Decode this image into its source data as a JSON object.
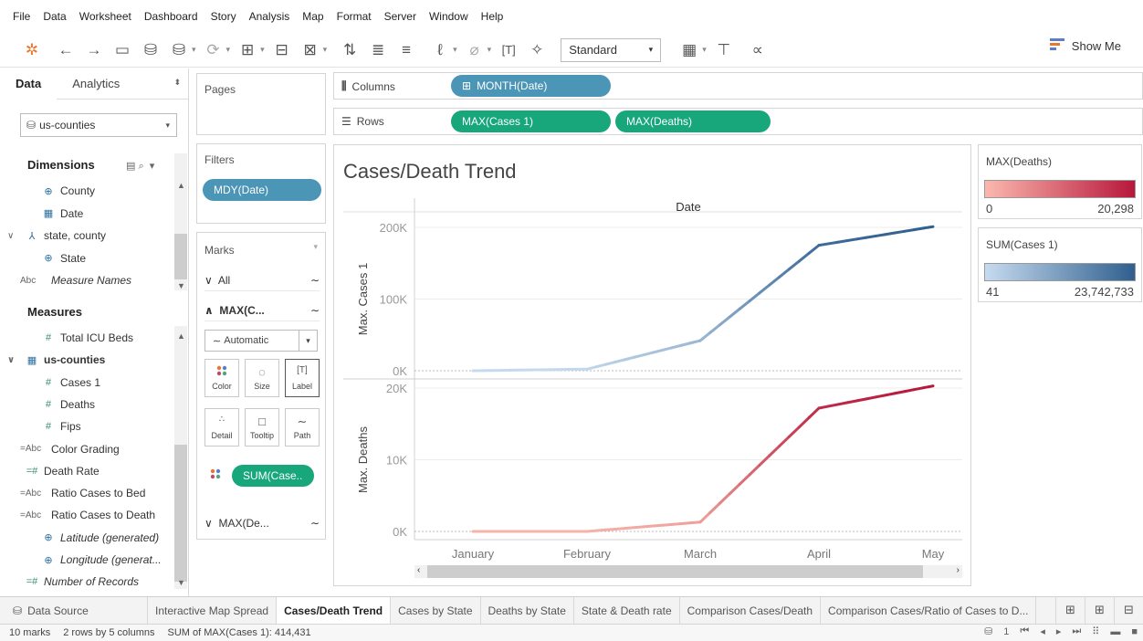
{
  "menu": [
    "File",
    "Data",
    "Worksheet",
    "Dashboard",
    "Story",
    "Analysis",
    "Map",
    "Format",
    "Server",
    "Window",
    "Help"
  ],
  "toolbar": {
    "fit_select": "Standard",
    "show_me": "Show Me"
  },
  "left_pane": {
    "tabs": [
      "Data",
      "Analytics"
    ],
    "datasource": "us-counties",
    "dimensions_label": "Dimensions",
    "dimensions": [
      {
        "label": "County",
        "icon": "globe-icon",
        "italic": false
      },
      {
        "label": "Date",
        "icon": "calendar-icon",
        "italic": false
      },
      {
        "label": "state, county",
        "icon": "hierarchy-icon",
        "italic": false
      },
      {
        "label": "State",
        "icon": "globe-icon",
        "italic": false
      },
      {
        "label": "Measure Names",
        "icon": "abc-icon",
        "italic": true
      }
    ],
    "measures_label": "Measures",
    "measures": [
      {
        "label": "Total ICU Beds",
        "icon": "number-icon",
        "italic": false
      },
      {
        "label": "us-counties",
        "icon": "table-icon",
        "italic": false
      },
      {
        "label": "Cases 1",
        "icon": "number-icon",
        "italic": false
      },
      {
        "label": "Deaths",
        "icon": "number-icon",
        "italic": false
      },
      {
        "label": "Fips",
        "icon": "number-icon",
        "italic": false
      },
      {
        "label": "Color Grading",
        "icon": "calc-abc-icon",
        "italic": false
      },
      {
        "label": "Death Rate",
        "icon": "calc-number-icon",
        "italic": false
      },
      {
        "label": "Ratio Cases to Bed",
        "icon": "calc-abc-icon",
        "italic": false
      },
      {
        "label": "Ratio Cases to Death",
        "icon": "calc-abc-icon",
        "italic": false
      },
      {
        "label": "Latitude (generated)",
        "icon": "globe-icon",
        "italic": true
      },
      {
        "label": "Longitude (generat...",
        "icon": "globe-icon",
        "italic": true
      },
      {
        "label": "Number of Records",
        "icon": "calc-number-icon",
        "italic": true
      }
    ]
  },
  "pages": {
    "title": "Pages"
  },
  "filters": {
    "title": "Filters",
    "pill": "MDY(Date)"
  },
  "marks": {
    "title": "Marks",
    "rows": [
      "All",
      "MAX(C...",
      "MAX(De..."
    ],
    "mark_type": "Automatic",
    "buttons": [
      "Color",
      "Size",
      "Label",
      "Detail",
      "Tooltip",
      "Path"
    ],
    "color_pill": "SUM(Case.."
  },
  "shelves": {
    "columns_label": "Columns",
    "columns_pill": "MONTH(Date)",
    "rows_label": "Rows",
    "rows_pills": [
      "MAX(Cases 1)",
      "MAX(Deaths)"
    ]
  },
  "view": {
    "title": "Cases/Death Trend",
    "header": "Date"
  },
  "chart_data": [
    {
      "type": "line",
      "title": "",
      "xlabel": "Date",
      "ylabel": "Max. Cases 1",
      "categories": [
        "January",
        "February",
        "March",
        "April",
        "May"
      ],
      "values": [
        1,
        2200,
        42000,
        175000,
        201000
      ],
      "ylim": [
        0,
        200000
      ],
      "yticks": [
        "0K",
        "100K",
        "200K"
      ],
      "color_low": "#c6dbef",
      "color_high": "#2f5f8f"
    },
    {
      "type": "line",
      "title": "",
      "xlabel": "Date",
      "ylabel": "Max. Deaths",
      "categories": [
        "January",
        "February",
        "March",
        "April",
        "May"
      ],
      "values": [
        0,
        0,
        1300,
        17200,
        20298
      ],
      "ylim": [
        0,
        20000
      ],
      "yticks": [
        "0K",
        "10K",
        "20K"
      ],
      "color_low": "#f6b3a8",
      "color_high": "#b7173b"
    }
  ],
  "legends": [
    {
      "title": "MAX(Deaths)",
      "low": "0",
      "high": "20,298",
      "color_low": "#fbb8ae",
      "color_high": "#b7173b"
    },
    {
      "title": "SUM(Cases 1)",
      "low": "41",
      "high": "23,742,733",
      "color_low": "#c6dbef",
      "color_high": "#2f5f8f"
    }
  ],
  "sheet_tabs": {
    "data_source": "Data Source",
    "tabs": [
      "Interactive Map Spread",
      "Cases/Death Trend",
      "Cases by State",
      "Deaths by State",
      "State & Death rate",
      "Comparison Cases/Death",
      "Comparison Cases/Ratio of Cases to D..."
    ],
    "active": 1
  },
  "status": {
    "marks": "10 marks",
    "rows_cols": "2 rows by 5 columns",
    "sum": "SUM of MAX(Cases 1): 414,431",
    "page": "1"
  }
}
